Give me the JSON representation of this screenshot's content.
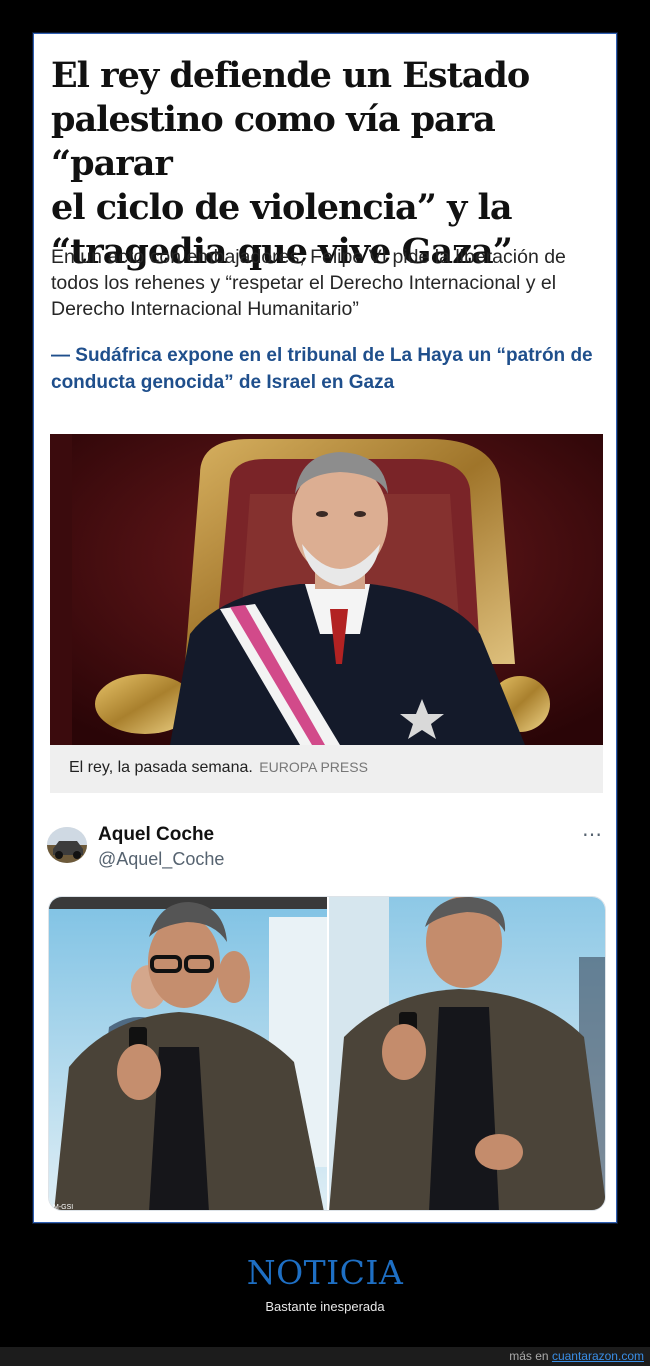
{
  "article": {
    "headline_lines": [
      "El rey defiende un Estado",
      "palestino como vía para “parar",
      "el ciclo de violencia” y la",
      "“tragedia que vive Gaza”"
    ],
    "subhead": "En un acto con embajadores, Felipe VI pide la liberación de todos los rehenes y “respetar el Derecho Internacional y el Derecho Internacional Humanitario”",
    "related_link": "— Sudáfrica expone en el tribunal de La Haya un “patrón de conducta genocida” de Israel en Gaza",
    "photo_caption": "El rey, la pasada semana.",
    "photo_credit": "EUROPA PRESS"
  },
  "tweet": {
    "name": "Aquel Coche",
    "handle": "@Aquel_Coche",
    "more_icon": "⋯",
    "watermark": "M-GSI"
  },
  "footer": {
    "title": "NOTICIA",
    "subtitle": "Bastante inesperada",
    "more_prefix": "más en",
    "more_link": "cuantarazon.com"
  },
  "colors": {
    "link_blue": "#1f4f8c",
    "footer_title": "#1e6fc4",
    "card_border": "#2f5fb3"
  }
}
